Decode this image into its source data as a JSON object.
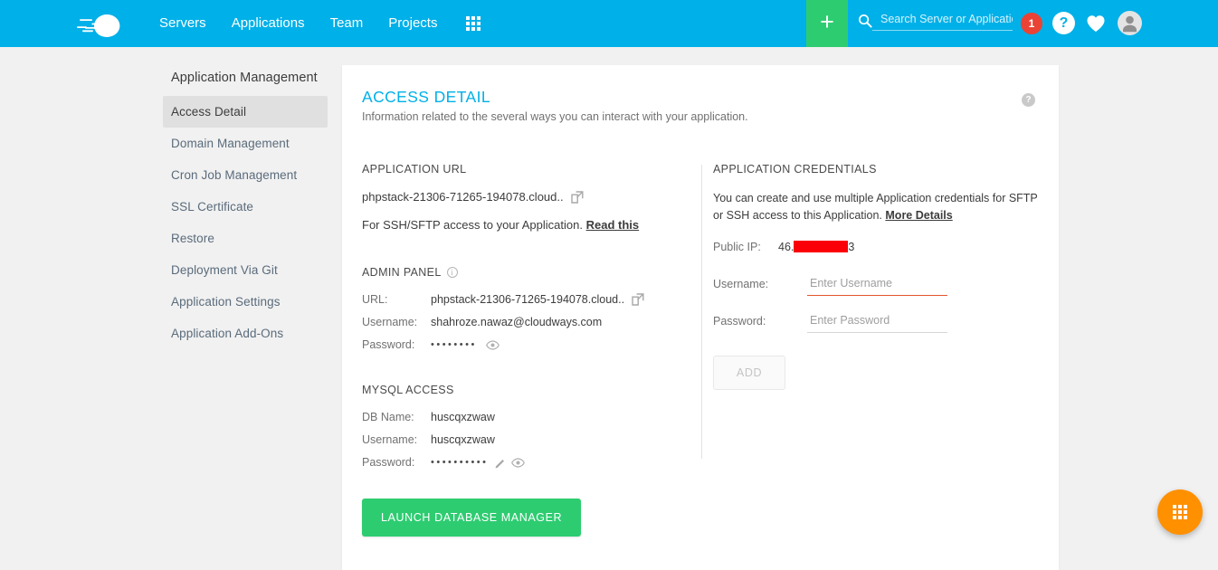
{
  "topnav": {
    "logo_icon": "cloudways-cloud-logo",
    "links": [
      {
        "label": "Servers"
      },
      {
        "label": "Applications"
      },
      {
        "label": "Team"
      },
      {
        "label": "Projects"
      }
    ],
    "apps_grid_icon": "grid-apps-icon",
    "add_button_label": "+",
    "search": {
      "icon": "search-icon",
      "value": "",
      "placeholder": "Search Server or Application"
    },
    "notification_count": "1",
    "help_label": "?",
    "heart_icon": "heart-icon",
    "avatar_icon": "user-avatar-icon"
  },
  "sidebar": {
    "title": "Application Management",
    "items": [
      {
        "label": "Access Detail",
        "active": true
      },
      {
        "label": "Domain Management",
        "active": false
      },
      {
        "label": "Cron Job Management",
        "active": false
      },
      {
        "label": "SSL Certificate",
        "active": false
      },
      {
        "label": "Restore",
        "active": false
      },
      {
        "label": "Deployment Via Git",
        "active": false
      },
      {
        "label": "Application Settings",
        "active": false
      },
      {
        "label": "Application Add-Ons",
        "active": false
      }
    ]
  },
  "card": {
    "title": "ACCESS DETAIL",
    "subtitle": "Information related to the several ways you can interact with your application.",
    "help_label": "?",
    "application_url": {
      "heading": "APPLICATION URL",
      "url": "phpstack-21306-71265-194078.cloud..",
      "external_link_icon": "external-link-icon",
      "ssh_text": "For SSH/SFTP access to your Application.",
      "ssh_link": "Read this"
    },
    "admin_panel": {
      "heading": "ADMIN PANEL",
      "info_icon": "info-icon",
      "url_label": "URL:",
      "url_value": "phpstack-21306-71265-194078.cloud..",
      "url_external_icon": "external-link-icon",
      "username_label": "Username:",
      "username_value": "shahroze.nawaz@cloudways.com",
      "password_label": "Password:",
      "password_masked": "••••••••",
      "password_eye_icon": "eye-icon"
    },
    "mysql_access": {
      "heading": "MYSQL ACCESS",
      "dbname_label": "DB Name:",
      "dbname_value": "huscqxzwaw",
      "username_label": "Username:",
      "username_value": "huscqxzwaw",
      "password_label": "Password:",
      "password_masked": "••••••••••",
      "password_edit_icon": "pencil-icon",
      "password_eye_icon": "eye-icon",
      "launch_button": "LAUNCH DATABASE MANAGER"
    },
    "application_credentials": {
      "heading": "APPLICATION CREDENTIALS",
      "description": "You can create and use multiple Application credentials for SFTP or SSH access to this Application.",
      "more_details_link": "More Details",
      "public_ip_label": "Public IP:",
      "public_ip_prefix": "46.",
      "public_ip_suffix": "3",
      "public_ip_redacted": true,
      "username_label": "Username:",
      "username_value": "",
      "username_placeholder": "Enter Username",
      "username_invalid": true,
      "password_label": "Password:",
      "password_value": "",
      "password_placeholder": "Enter Password",
      "add_button": "ADD"
    }
  },
  "fab": {
    "icon": "grid-apps-icon"
  },
  "colors": {
    "brand_blue": "#00b0e8",
    "green": "#2ecc71",
    "orange_fab": "#ff9000",
    "badge_red": "#ea4335",
    "redaction_red": "#fb0007",
    "invalid_underline": "#e2572c",
    "page_bg": "#f1f1f1"
  }
}
